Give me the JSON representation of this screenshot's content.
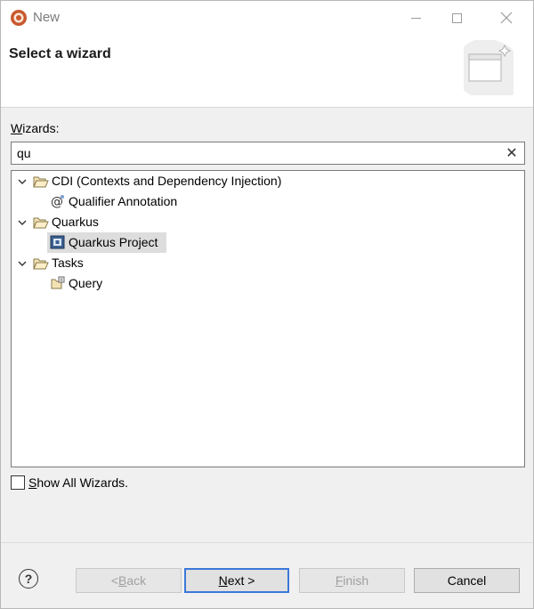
{
  "window": {
    "title": "New",
    "controls": {
      "minimize": "minimize",
      "maximize": "maximize",
      "close": "close"
    }
  },
  "banner": {
    "title": "Select a wizard"
  },
  "wizards": {
    "label_prefix": "W",
    "label_rest": "izards:",
    "filter_value": "qu",
    "clear_glyph": "✕"
  },
  "tree": {
    "items": [
      {
        "type": "category",
        "label": "CDI (Contexts and Dependency Injection)",
        "expanded": true,
        "icon": "folder-open-icon"
      },
      {
        "type": "wizard",
        "label": "Qualifier Annotation",
        "icon": "annotation-icon"
      },
      {
        "type": "category",
        "label": "Quarkus",
        "expanded": true,
        "icon": "folder-open-icon"
      },
      {
        "type": "wizard",
        "label": "Quarkus Project",
        "icon": "quarkus-project-icon",
        "selected": true
      },
      {
        "type": "category",
        "label": "Tasks",
        "expanded": true,
        "icon": "folder-open-icon"
      },
      {
        "type": "wizard",
        "label": "Query",
        "icon": "query-icon"
      }
    ]
  },
  "show_all": {
    "prefix": "S",
    "rest": "how All Wizards.",
    "checked": false
  },
  "footer": {
    "help_glyph": "?",
    "back": {
      "mnemonic": "B",
      "pre": "< ",
      "post": "ack"
    },
    "next": {
      "mnemonic": "N",
      "pre": "",
      "post": "ext >"
    },
    "finish": {
      "mnemonic": "F",
      "pre": "",
      "post": "inish"
    },
    "cancel": "Cancel"
  },
  "colors": {
    "selection": "#dddddd",
    "default_button_border": "#3b78d8",
    "disabled_text": "#a0a0a0"
  }
}
